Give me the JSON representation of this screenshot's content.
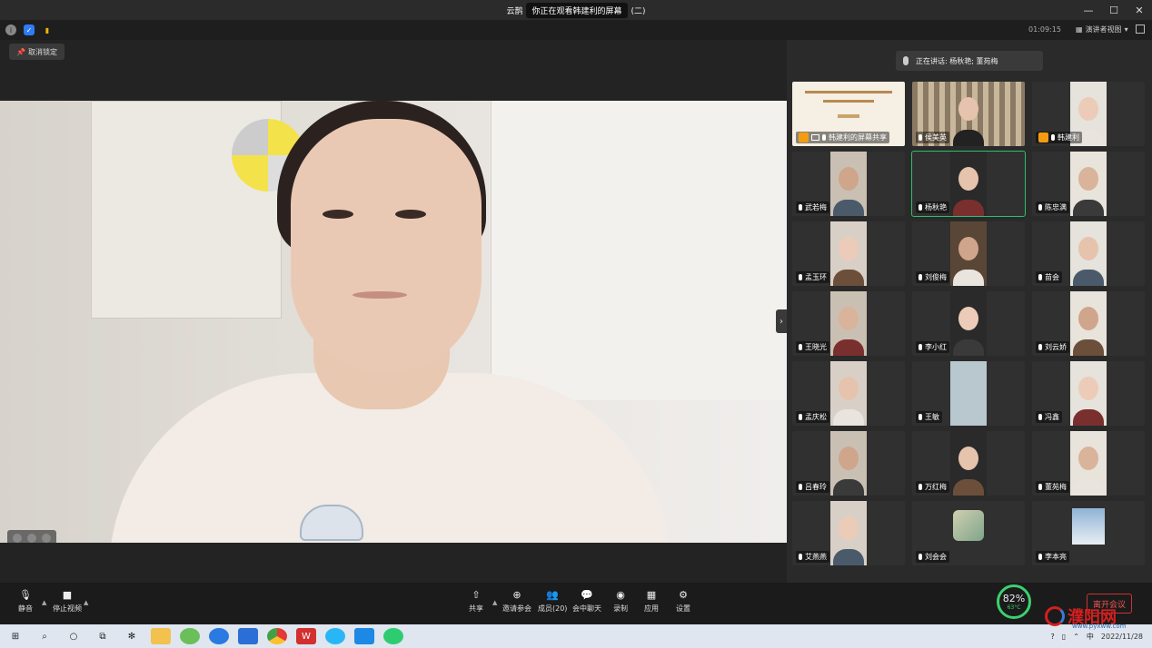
{
  "titlebar": {
    "app_name": "云鹊",
    "sharing_notice": "你正在观看韩建利的屏幕",
    "sharing_suffix": "(二)",
    "window_controls": [
      "minimize",
      "maximize",
      "close"
    ]
  },
  "toolbar": {
    "timer": "01:09:15",
    "view_label": "演讲者视图"
  },
  "stage": {
    "unlock_label": "取消锁定"
  },
  "side": {
    "speaking_label": "正在讲话: 杨秋艳; 董苑梅",
    "participants": [
      {
        "name": "韩建利的屏幕共享",
        "type": "screen"
      },
      {
        "name": "侯美英",
        "type": "shelf"
      },
      {
        "name": "韩建利",
        "type": "person"
      },
      {
        "name": "武若梅",
        "type": "person"
      },
      {
        "name": "杨秋艳",
        "type": "person",
        "active": true
      },
      {
        "name": "陈忠满",
        "type": "person"
      },
      {
        "name": "孟玉环",
        "type": "person"
      },
      {
        "name": "刘俊梅",
        "type": "person"
      },
      {
        "name": "苗会",
        "type": "person"
      },
      {
        "name": "王晓光",
        "type": "person"
      },
      {
        "name": "李小红",
        "type": "person"
      },
      {
        "name": "刘云娇",
        "type": "person"
      },
      {
        "name": "孟庆松",
        "type": "person"
      },
      {
        "name": "王敏",
        "type": "blank"
      },
      {
        "name": "冯鑫",
        "type": "person"
      },
      {
        "name": "吕春玲",
        "type": "person"
      },
      {
        "name": "万红梅",
        "type": "person"
      },
      {
        "name": "董苑梅",
        "type": "person"
      },
      {
        "name": "艾燕燕",
        "type": "person"
      },
      {
        "name": "刘会会",
        "type": "image"
      },
      {
        "name": "李本亮",
        "type": "tower"
      }
    ]
  },
  "bottombar": {
    "mute": "静音",
    "stop_video": "停止视频",
    "share": "共享",
    "invite": "邀请参会",
    "members": "成员(20)",
    "chat": "会中聊天",
    "record": "录制",
    "apps": "应用",
    "settings": "设置",
    "leave": "离开会议",
    "cpu_percent": "82%",
    "cpu_temp": "63°C"
  },
  "taskbar": {
    "ime": "中",
    "date": "2022/11/28"
  },
  "watermark": {
    "brand": "濮阳网",
    "url": "www.pyxww.com"
  },
  "colors": {
    "active_border": "#2fbf6a",
    "leave_red": "#e55555",
    "cpu_green": "#3bd16f",
    "host_badge": "#f39c12"
  }
}
